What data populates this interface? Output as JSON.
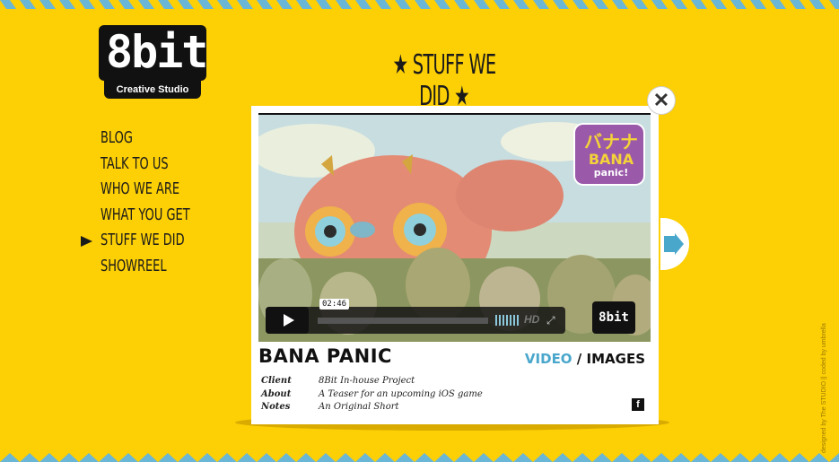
{
  "logo": {
    "text": "8bit",
    "tagline": "Creative Studio"
  },
  "page_title": "STUFF WE DID",
  "nav": {
    "items": [
      "BLOG",
      "TALK TO US",
      "WHO WE ARE",
      "WHAT YOU GET",
      "STUFF WE DID",
      "SHOWREEL"
    ],
    "active": "STUFF WE DID"
  },
  "project": {
    "name": "BANA PANIC",
    "tab_video": "VIDEO",
    "tab_sep": "/",
    "tab_images": "IMAGES",
    "client_label": "Client",
    "client": "8Bit In-house Project",
    "about_label": "About",
    "about": "A Teaser for an upcoming iOS game",
    "notes_label": "Notes",
    "notes": "An Original Short"
  },
  "video": {
    "time": "02:46",
    "hd": "HD",
    "game_logo_jp": "バナナ",
    "game_logo": "BANA",
    "game_logo2": "panic!",
    "brand": "8bit"
  },
  "social": {
    "facebook": "f"
  },
  "credit": "designed by The STUDIO || coded by umbrella",
  "colors": {
    "background": "#fdcf05",
    "accent": "#4aa7cc",
    "zigzag": "#6ab6d6"
  }
}
